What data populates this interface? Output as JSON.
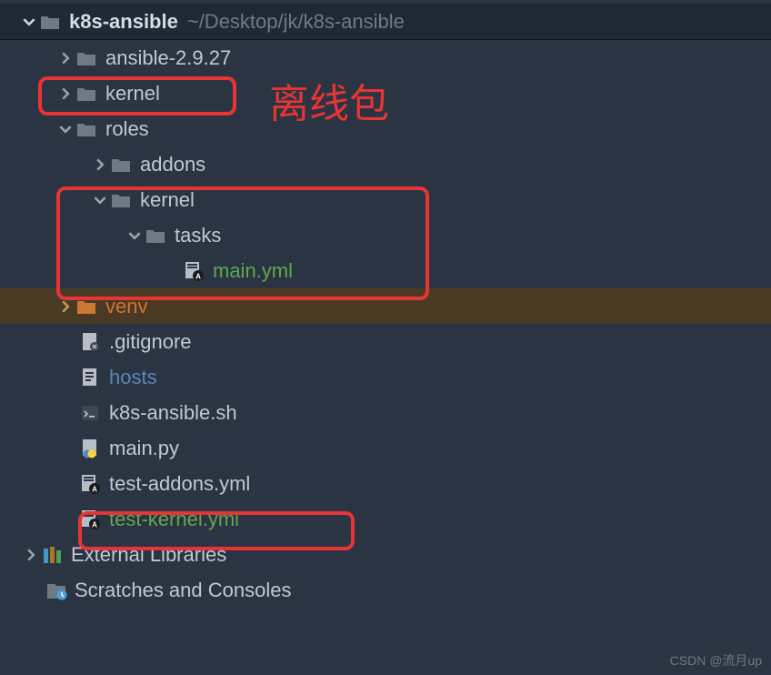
{
  "header": {
    "project_name": "k8s-ansible",
    "project_path": "~/Desktop/jk/k8s-ansible"
  },
  "tree": {
    "ansible_dir": "ansible-2.9.27",
    "kernel_dir": "kernel",
    "roles_dir": "roles",
    "addons_dir": "addons",
    "roles_kernel_dir": "kernel",
    "tasks_dir": "tasks",
    "main_yml": "main.yml",
    "venv_dir": "venv",
    "gitignore": ".gitignore",
    "hosts": "hosts",
    "k8s_ansible_sh": "k8s-ansible.sh",
    "main_py": "main.py",
    "test_addons_yml": "test-addons.yml",
    "test_kernel_yml": "test-kernel.yml",
    "external_libs": "External Libraries",
    "scratches": "Scratches and Consoles"
  },
  "annotations": {
    "offline_pkg": "离线包"
  },
  "watermark": "CSDN @流月up"
}
